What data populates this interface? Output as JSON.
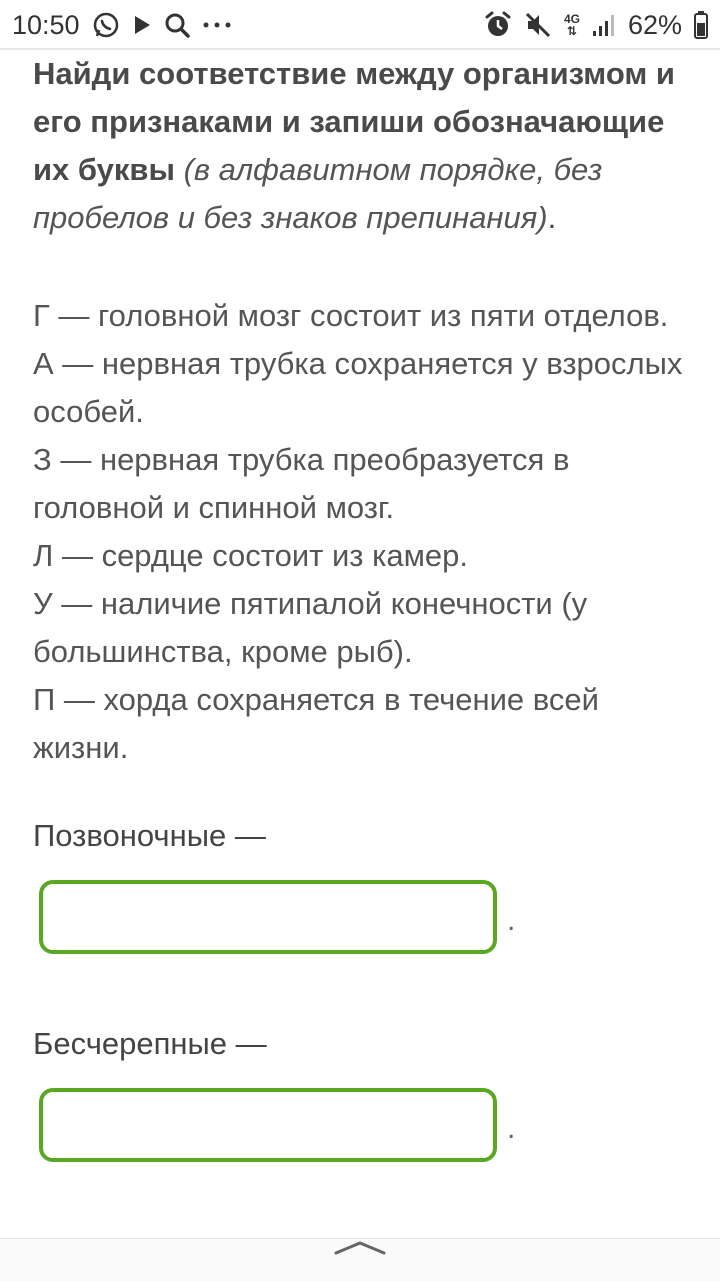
{
  "status_bar": {
    "time": "10:50",
    "battery": "62%",
    "network": "4G"
  },
  "task": {
    "title_bold": "Найди соответствие между организмом и его признаками и запиши обозначающие их буквы",
    "title_hint": "(в алфавитном порядке, без пробелов и без знаков препинания)",
    "title_end": "."
  },
  "items": [
    "Г — головной мозг состоит из пяти отделов.",
    "А — нервная трубка сохраняется у взрослых особей.",
    "З — нервная трубка преобразуется в головной и спинной мозг.",
    "Л — сердце состоит из камер.",
    "У — наличие пятипалой конечности (у большинства, кроме рыб).",
    "П — хорда сохраняется в течение всей жизни."
  ],
  "answers": [
    {
      "label": "Позвоночные —",
      "value": "",
      "period": "."
    },
    {
      "label": "Бесчерепные —",
      "value": "",
      "period": "."
    }
  ],
  "colors": {
    "input_border": "#5aa722"
  },
  "icons": [
    "whatsapp-icon",
    "play-icon",
    "search-icon",
    "more-icon",
    "alarm-icon",
    "mute-icon",
    "signal-icon",
    "chevron-up-icon"
  ]
}
